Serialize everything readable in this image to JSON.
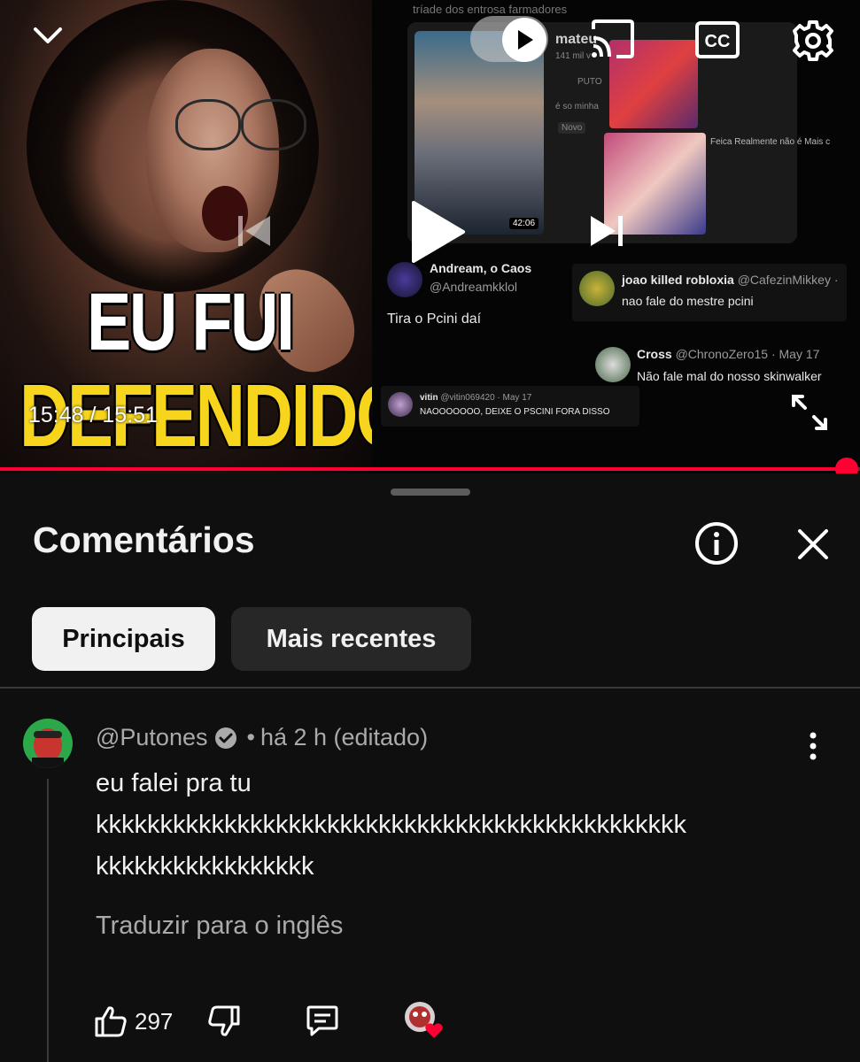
{
  "player": {
    "current_time": "15:48",
    "duration": "15:51",
    "time_display": "15:48 / 15:51",
    "progress_fraction": 0.985,
    "thumbnail_title_line1": "EU FUI",
    "thumbnail_title_line2": "DEFENDIDO",
    "embedded": {
      "top_caption": "tríade dos entrosa farmadores",
      "channel_partial": "mateu",
      "views_partial": "141 mil v",
      "video_duration": "42:06",
      "mini_1": "PUTO",
      "mini_2": "é so minha",
      "mini_3": "Novo",
      "card_title": "Feica Realmente não é Mais c"
    },
    "overlay_comments": [
      {
        "name": "Andream, o Caos",
        "handle": "@Andreamkklol",
        "text": "Tira o Pcini daí"
      },
      {
        "name": "joao killed robloxia",
        "handle": "@CafezinMikkey ·",
        "text": "nao fale do mestre pcini"
      },
      {
        "name": "Cross",
        "handle": "@ChronoZero15 · May 17",
        "text": "Não fale mal do nosso skinwalker"
      },
      {
        "name": "vitin",
        "handle": "@vitin069420 · May 17",
        "text": "NAOOOOOOO, DEIXE O PSCINI FORA DISSO"
      }
    ],
    "icons": [
      "chevron-down-icon",
      "cast-icon",
      "captions-icon",
      "settings-icon",
      "previous-icon",
      "play-icon",
      "next-icon",
      "fullscreen-icon"
    ],
    "accent_color": "#ff0033"
  },
  "comments_sheet": {
    "title": "Comentários",
    "filters": [
      {
        "label": "Principais",
        "active": true
      },
      {
        "label": "Mais recentes",
        "active": false
      }
    ],
    "comment": {
      "author": "@Putones",
      "verified": true,
      "meta": "há 2 h (editado)",
      "body_lines": [
        "eu falei pra tu",
        "kkkkkkkkkkkkkkkkkkkkkkkkkkkkkkkkkkkkkkkkkkkkkk",
        "kkkkkkkkkkkkkkkkk"
      ],
      "translate_label": "Traduzir para o inglês",
      "likes": "297"
    }
  }
}
